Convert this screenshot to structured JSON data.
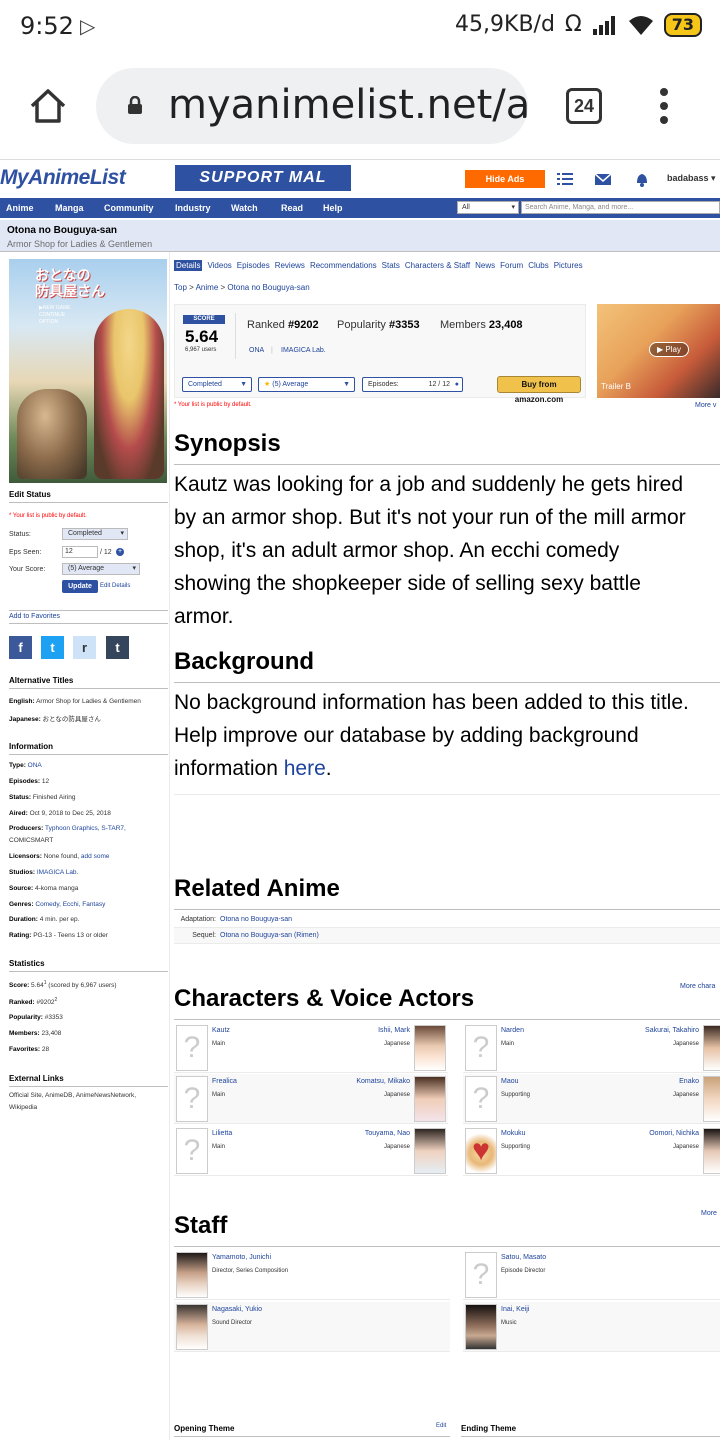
{
  "status_bar": {
    "time": "9:52",
    "net_speed": "45,9KB/d",
    "battery": "73"
  },
  "browser": {
    "url": "myanimelist.net/a",
    "tab_count": "24"
  },
  "header": {
    "logo": "MyAnimeList",
    "banner": "SUPPORT MAL",
    "hide_ads": "Hide Ads",
    "username": "badabass ▾"
  },
  "nav": {
    "items": [
      "Anime",
      "Manga",
      "Community",
      "Industry",
      "Watch",
      "Read",
      "Help"
    ],
    "search_category": "All",
    "search_placeholder": "Search Anime, Manga, and more..."
  },
  "title": {
    "main": "Otona no Bouguya-san",
    "english": "Armor Shop for Ladies & Gentlemen"
  },
  "cover": {
    "title_lines": [
      "おとなの",
      "防具屋さん"
    ],
    "menu_lines": [
      "▶NEW GAME",
      "CONTINUE",
      "OPTION"
    ]
  },
  "edit_status": {
    "heading": "Edit Status",
    "note": "* Your list is public by default.",
    "status_label": "Status:",
    "status_value": "Completed",
    "eps_label": "Eps Seen:",
    "eps_value": "12",
    "eps_total": "/ 12",
    "score_label": "Your Score:",
    "score_value": "(5) Average",
    "update": "Update",
    "edit_details": "Edit Details",
    "add_favorites": "Add to Favorites"
  },
  "social": {
    "facebook": "f",
    "twitter": "t",
    "reddit": "r",
    "tumblr": "t"
  },
  "alt_titles": {
    "heading": "Alternative Titles",
    "english_label": "English:",
    "english": "Armor Shop for Ladies & Gentlemen",
    "japanese_label": "Japanese:",
    "japanese": "おとなの防具屋さん"
  },
  "information": {
    "heading": "Information",
    "type_label": "Type:",
    "type": "ONA",
    "episodes_label": "Episodes:",
    "episodes": "12",
    "status_label": "Status:",
    "status": "Finished Airing",
    "aired_label": "Aired:",
    "aired": "Oct 9, 2018 to Dec 25, 2018",
    "producers_label": "Producers:",
    "producers": "Typhoon Graphics, S-TAR7,",
    "producers2": "COMICSMART",
    "licensors_label": "Licensors:",
    "licensors": "None found,",
    "licensors_link": "add some",
    "studios_label": "Studios:",
    "studios": "IMAGICA Lab.",
    "source_label": "Source:",
    "source": "4-koma manga",
    "genres_label": "Genres:",
    "genres": "Comedy, Ecchi, Fantasy",
    "duration_label": "Duration:",
    "duration": "4 min. per ep.",
    "rating_label": "Rating:",
    "rating": "PG-13 - Teens 13 or older"
  },
  "statistics": {
    "heading": "Statistics",
    "score_label": "Score:",
    "score": "5.64",
    "score_sup": "1",
    "score_note": "(scored by 6,967 users)",
    "ranked_label": "Ranked:",
    "ranked": "#9202",
    "ranked_sup": "2",
    "popularity_label": "Popularity:",
    "popularity": "#3353",
    "members_label": "Members:",
    "members": "23,408",
    "favorites_label": "Favorites:",
    "favorites": "28"
  },
  "external_links": {
    "heading": "External Links",
    "line1": "Official Site, AnimeDB, AnimeNewsNetwork,",
    "line2": "Wikipedia"
  },
  "tabs": [
    "Details",
    "Videos",
    "Episodes",
    "Reviews",
    "Recommendations",
    "Stats",
    "Characters & Staff",
    "News",
    "Forum",
    "Clubs",
    "Pictures"
  ],
  "breadcrumb": [
    "Top",
    "Anime",
    "Otona no Bouguya-san"
  ],
  "stats_box": {
    "score_label": "SCORE",
    "score": "5.64",
    "score_users": "6,967 users",
    "ranked_label": "Ranked",
    "ranked": "#9202",
    "popularity_label": "Popularity",
    "popularity": "#3353",
    "members_label": "Members",
    "members": "23,408",
    "type": "ONA",
    "studio": "IMAGICA Lab.",
    "status_select": "Completed",
    "score_select": "(5) Average",
    "episodes_label": "Episodes:",
    "episodes_value": "12 / 12",
    "amazon": "Buy from amazon.com",
    "note": "* Your list is public by default."
  },
  "trailer": {
    "play": "Play",
    "label": "Trailer B",
    "more": "More v"
  },
  "synopsis": {
    "heading": "Synopsis",
    "lines": [
      "Kautz was looking for a job and suddenly he gets hired",
      "by an armor shop. But it's not your run of the mill armor",
      "shop, it's an adult armor shop. An ecchi comedy",
      "showing the shopkeeper side of selling sexy battle",
      "armor."
    ]
  },
  "background": {
    "heading": "Background",
    "lines": [
      "No background information has been added to this title.",
      "Help improve our database by adding background"
    ],
    "line3_prefix": "information ",
    "line3_link": "here",
    "line3_suffix": "."
  },
  "related": {
    "heading": "Related Anime",
    "rows": [
      {
        "label": "Adaptation:",
        "value": "Otona no Bouguya-san"
      },
      {
        "label": "Sequel:",
        "value": "Otona no Bouguya-san (Rimen)"
      }
    ]
  },
  "characters": {
    "heading": "Characters & Voice Actors",
    "more": "More chara",
    "items": [
      {
        "name": "Kautz",
        "role": "Main",
        "va": "Ishii, Mark",
        "lang": "Japanese"
      },
      {
        "name": "Narden",
        "role": "Main",
        "va": "Sakurai, Takahiro",
        "lang": "Japanese"
      },
      {
        "name": "Frealica",
        "role": "Main",
        "va": "Komatsu, Mikako",
        "lang": "Japanese"
      },
      {
        "name": "Maou",
        "role": "Supporting",
        "va": "Enako",
        "lang": "Japanese"
      },
      {
        "name": "Lilietta",
        "role": "Main",
        "va": "Touyama, Nao",
        "lang": "Japanese"
      },
      {
        "name": "Mokuku",
        "role": "Supporting",
        "va": "Oomori, Nichika",
        "lang": "Japanese"
      }
    ]
  },
  "staff": {
    "heading": "Staff",
    "more": "More",
    "items": [
      {
        "name": "Yamamoto, Junichi",
        "role": "Director, Series Composition"
      },
      {
        "name": "Satou, Masato",
        "role": "Episode Director"
      },
      {
        "name": "Nagasaki, Yukio",
        "role": "Sound Director"
      },
      {
        "name": "Inai, Keiji",
        "role": "Music"
      }
    ]
  },
  "themes": {
    "opening": "Opening Theme",
    "edit": "Edit",
    "ending": "Ending Theme"
  },
  "colors": {
    "mal_blue": "#2e51a2",
    "link": "#1d439b",
    "title_bg": "#e1e7f5",
    "orange": "#ff6a00"
  }
}
